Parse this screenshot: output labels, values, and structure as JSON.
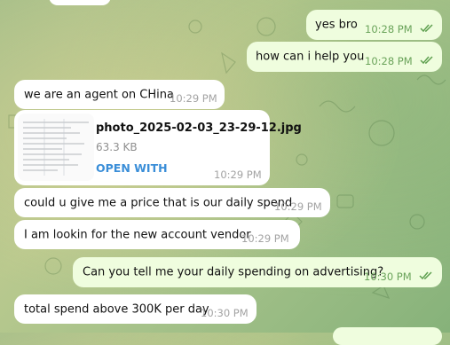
{
  "messages": [
    {
      "text": "yes bro",
      "time": "10:28 PM"
    },
    {
      "text": "how can i help you",
      "time": "10:28 PM"
    },
    {
      "text": "we are an agent on CHina",
      "time": "10:29 PM"
    },
    {
      "file_name": "photo_2025-02-03_23-29-12.jpg",
      "file_size": "63.3 KB",
      "open_label": "OPEN WITH",
      "time": "10:29 PM"
    },
    {
      "text": "could u give me a price that is our daily spend",
      "time": "10:29 PM"
    },
    {
      "text": "I am lookin for the new account vendor",
      "time": "10:29 PM"
    },
    {
      "text": "Can you tell me your daily spending on advertising?",
      "time": "10:30 PM"
    },
    {
      "text": "total spend above 300K per day",
      "time": "10:30 PM"
    }
  ],
  "colors": {
    "incoming": "#ffffff",
    "outgoing": "#effdde",
    "link": "#3a8ed8",
    "check": "#5fa050"
  },
  "icons": {
    "read": "double-check-icon"
  }
}
